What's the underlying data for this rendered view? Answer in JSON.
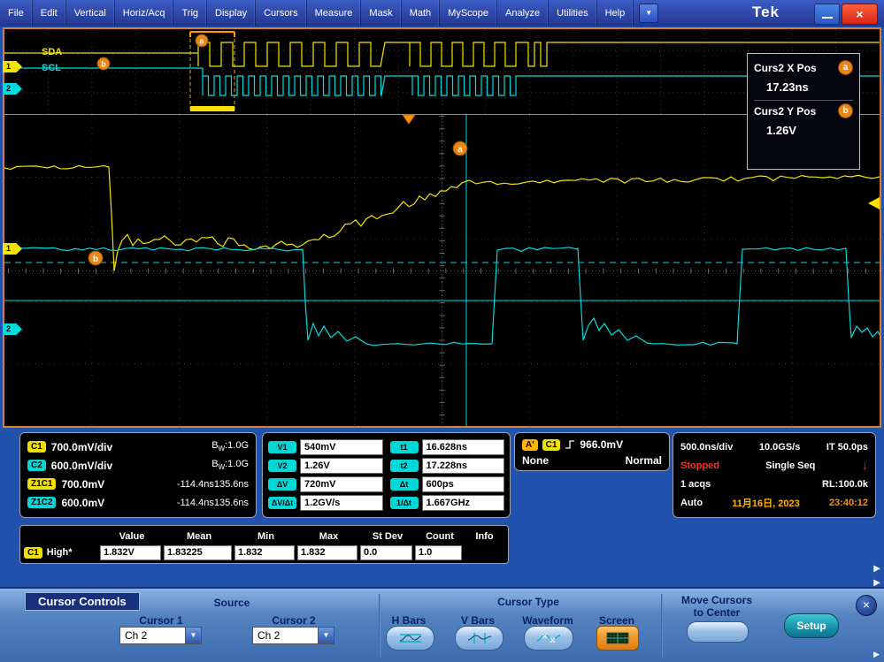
{
  "menu": {
    "items": [
      "File",
      "Edit",
      "Vertical",
      "Horiz/Acq",
      "Trig",
      "Display",
      "Cursors",
      "Measure",
      "Mask",
      "Math",
      "MyScope",
      "Analyze",
      "Utilities",
      "Help"
    ],
    "brand": "Tek"
  },
  "display": {
    "sda_label": "SDA",
    "scl_label": "SCL",
    "ch1_tag": "1",
    "ch2_tag": "2",
    "marker_a": "a",
    "marker_b": "b",
    "cursor_box": {
      "x_label": "Curs2 X Pos",
      "x_value": "17.23ns",
      "y_label": "Curs2 Y Pos",
      "y_value": "1.26V"
    }
  },
  "status": {
    "vertical": [
      {
        "badge": "C1",
        "value": "700.0mV/div",
        "b": "B",
        "w": "W",
        "v": ":1.0G"
      },
      {
        "badge": "C2",
        "value": "600.0mV/div",
        "b": "B",
        "w": "W",
        "v": ":1.0G"
      },
      {
        "badge": "Z1C1",
        "value": "700.0mV",
        "p1": "-114.4ns",
        "p2": "135.6ns"
      },
      {
        "badge": "Z1C2",
        "value": "600.0mV",
        "p1": "-114.4ns",
        "p2": "135.6ns"
      }
    ],
    "cmeas": {
      "left": [
        {
          "b": "V1",
          "v": "540mV"
        },
        {
          "b": "V2",
          "v": "1.26V"
        },
        {
          "b": "ΔV",
          "v": "720mV"
        },
        {
          "b": "ΔV/Δt",
          "v": "1.2GV/s"
        }
      ],
      "right": [
        {
          "b": "t1",
          "v": "16.628ns"
        },
        {
          "b": "t2",
          "v": "17.228ns"
        },
        {
          "b": "Δt",
          "v": "600ps"
        },
        {
          "b": "1/Δt",
          "v": "1.667GHz"
        }
      ]
    },
    "trigger": {
      "a": "A'",
      "src": "C1",
      "level": "966.0mV",
      "left": "None",
      "right": "Normal"
    },
    "horiz": {
      "tb": "500.0ns/div",
      "sr": "10.0GS/s",
      "it": "IT 50.0ps",
      "state": "Stopped",
      "seq": "Single Seq",
      "acqs": "1 acqs",
      "rl": "RL:100.0k",
      "auto": "Auto",
      "date": "11月16日, 2023",
      "time": "23:40:12"
    }
  },
  "meas": {
    "headers": [
      "Value",
      "Mean",
      "Min",
      "Max",
      "St Dev",
      "Count",
      "Info"
    ],
    "row": {
      "badge": "C1",
      "name": "High*",
      "value": "1.832V",
      "mean": "1.83225",
      "min": "1.832",
      "max": "1.832",
      "stdev": "0.0",
      "count": "1.0",
      "info": ""
    }
  },
  "panel": {
    "title": "Cursor Controls",
    "source": "Source",
    "c1": "Cursor 1",
    "c1v": "Ch 2",
    "c2": "Cursor 2",
    "c2v": "Ch 2",
    "type": "Cursor Type",
    "types": [
      {
        "label": "H Bars"
      },
      {
        "label": "V Bars"
      },
      {
        "label": "Waveform"
      },
      {
        "label": "Screen"
      }
    ],
    "move1": "Move Cursors",
    "move2": "to Center",
    "setup": "Setup"
  },
  "colors": {
    "ch1": "#f5e400",
    "ch2": "#00dce0",
    "marker": "#e8861a",
    "stopped": "#ff3020",
    "timestamp": "#ff9000",
    "frame": "#dd8218"
  }
}
